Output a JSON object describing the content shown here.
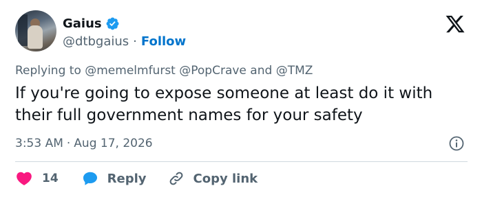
{
  "author": {
    "name": "Gaius",
    "handle": "@dtbgaius",
    "separator": "·",
    "follow_label": "Follow",
    "verified_icon": "verified-badge-icon",
    "avatar_icon": "avatar"
  },
  "brand": {
    "logo_icon": "x-logo-icon"
  },
  "reply_context": {
    "prefix": "Replying to",
    "mention1": "@memelmfurst",
    "mention2": "@PopCrave",
    "conjunction": "and",
    "mention3": "@TMZ"
  },
  "tweet": {
    "text": "If you're going to expose someone at least do it with their full government names for your safety",
    "time": "3:53 AM",
    "separator": "·",
    "date": "Aug 17, 2026",
    "info_icon": "info-icon"
  },
  "actions": {
    "like_count": "14",
    "reply_label": "Reply",
    "copy_label": "Copy link"
  },
  "colors": {
    "link": "#0074cc",
    "verified": "#1d9bf0",
    "like": "#f91880",
    "reply": "#1d9bf0",
    "muted": "#536471",
    "text": "#0f1419"
  }
}
